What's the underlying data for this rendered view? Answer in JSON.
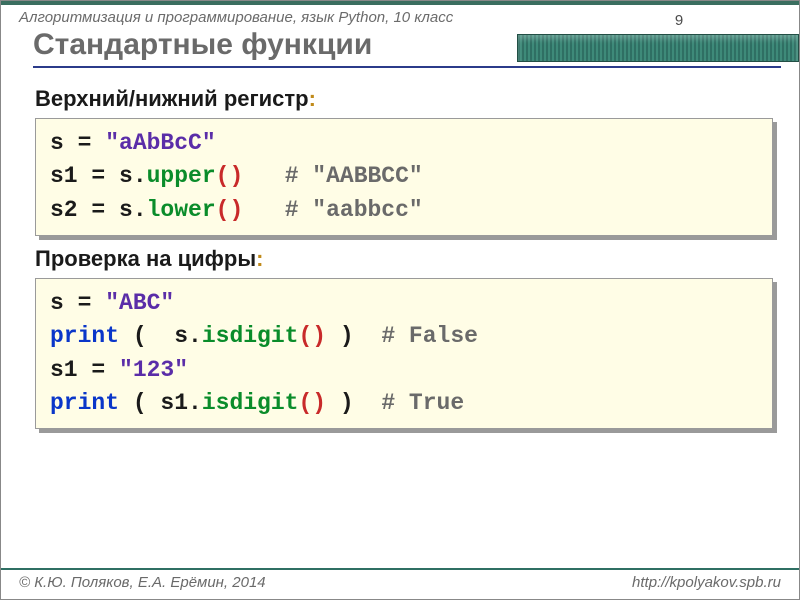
{
  "breadcrumb": "Алгоритмизация и программирование, язык Python, 10 класс",
  "page_number": "9",
  "title": "Стандартные функции",
  "section1_label": "Верхний/нижний регистр",
  "section2_label": "Проверка на цифры",
  "code1": {
    "l1_a": "s = ",
    "l1_str": "\"aAbBcC\"",
    "l2_a": "s1 = s.",
    "l2_meth": "upper",
    "l2_par1": "(",
    "l2_par2": ")",
    "l2_pad": "   ",
    "l2_cmt": "# \"AABBCC\"",
    "l3_a": "s2 = s.",
    "l3_meth": "lower",
    "l3_par1": "(",
    "l3_par2": ")",
    "l3_pad": "   ",
    "l3_cmt": "# \"aabbcc\""
  },
  "code2": {
    "l1_a": "s = ",
    "l1_str": "\"ABC\"",
    "l2_kw": "print",
    "l2_a": " (  s.",
    "l2_meth": "isdigit",
    "l2_par1": "(",
    "l2_par2": ")",
    "l2_b": " )  ",
    "l2_cmt": "# False",
    "l3_a": "s1 = ",
    "l3_str": "\"123\"",
    "l4_kw": "print",
    "l4_a": " ( s1.",
    "l4_meth": "isdigit",
    "l4_par1": "(",
    "l4_par2": ")",
    "l4_b": " )  ",
    "l4_cmt": "# True"
  },
  "footer": {
    "copyright": "© К.Ю. Поляков, Е.А. Ерёмин, 2014",
    "url": "http://kpolyakov.spb.ru"
  }
}
